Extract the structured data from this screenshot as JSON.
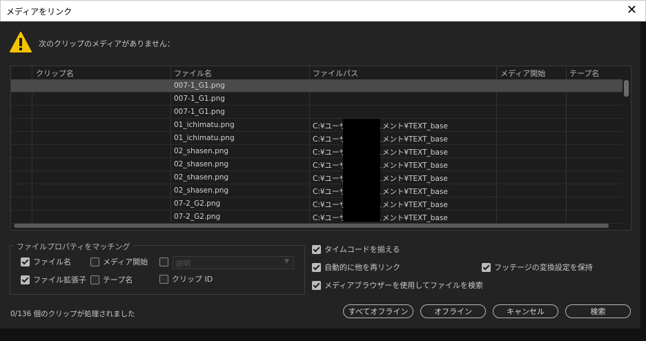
{
  "window": {
    "title": "メディアをリンク"
  },
  "message": "次のクリップのメディアがありません：",
  "table": {
    "columns": [
      "クリップ名",
      "ファイル名",
      "ファイルパス",
      "メディア開始",
      "テープ名"
    ],
    "rows": [
      {
        "clip": "",
        "file": "007-1_G1.png",
        "path": "",
        "start": "",
        "tape": ""
      },
      {
        "clip": "",
        "file": "007-1_G1.png",
        "path": "",
        "start": "",
        "tape": ""
      },
      {
        "clip": "",
        "file": "007-1_G1.png",
        "path": "",
        "start": "",
        "tape": ""
      },
      {
        "clip": "",
        "file": "01_ichimatu.png",
        "path": "C:¥ユーザー¥      ドキュメント¥TEXT_base",
        "start": "",
        "tape": ""
      },
      {
        "clip": "",
        "file": "01_ichimatu.png",
        "path": "C:¥ユーザー¥      ドキュメント¥TEXT_base",
        "start": "",
        "tape": ""
      },
      {
        "clip": "",
        "file": "02_shasen.png",
        "path": "C:¥ユーザー¥      ドキュメント¥TEXT_base",
        "start": "",
        "tape": ""
      },
      {
        "clip": "",
        "file": "02_shasen.png",
        "path": "C:¥ユーザー¥      ドキュメント¥TEXT_base",
        "start": "",
        "tape": ""
      },
      {
        "clip": "",
        "file": "02_shasen.png",
        "path": "C:¥ユーザー¥      ドキュメント¥TEXT_base",
        "start": "",
        "tape": ""
      },
      {
        "clip": "",
        "file": "02_shasen.png",
        "path": "C:¥ユーザー¥      ドキュメント¥TEXT_base",
        "start": "",
        "tape": ""
      },
      {
        "clip": "",
        "file": "07-2_G2.png",
        "path": "C:¥ユーザー¥      ドキュメント¥TEXT_base",
        "start": "",
        "tape": ""
      },
      {
        "clip": "",
        "file": "07-2_G2.png",
        "path": "C:¥ユーザー¥      ドキュメント¥TEXT_base",
        "start": "",
        "tape": ""
      }
    ]
  },
  "matching": {
    "legend": "ファイルプロパティをマッチング",
    "file_name": {
      "label": "ファイル名",
      "checked": true
    },
    "media_start": {
      "label": "メディア開始",
      "checked": false
    },
    "description": {
      "label": "",
      "checked": false
    },
    "description_select": "説明",
    "file_ext": {
      "label": "ファイル拡張子",
      "checked": true
    },
    "tape_name": {
      "label": "テープ名",
      "checked": false
    },
    "clip_id": {
      "label": "クリップ ID",
      "checked": false
    }
  },
  "options": {
    "align_timecode": {
      "label": "タイムコードを揃える",
      "checked": true
    },
    "relink_others": {
      "label": "自動的に他を再リンク",
      "checked": true
    },
    "keep_footage": {
      "label": "フッテージの変換設定を保持",
      "checked": true
    },
    "use_browser": {
      "label": "メディアブラウザーを使用してファイルを検索",
      "checked": true
    }
  },
  "status": "0/136 個のクリップが処理されました",
  "buttons": {
    "offline_all": "すべてオフライン",
    "offline": "オフライン",
    "cancel": "キャンセル",
    "search": "検索"
  },
  "colors": {
    "warning": "#f5c400",
    "background": "#232323",
    "selected_row": "#4a4a4a"
  }
}
